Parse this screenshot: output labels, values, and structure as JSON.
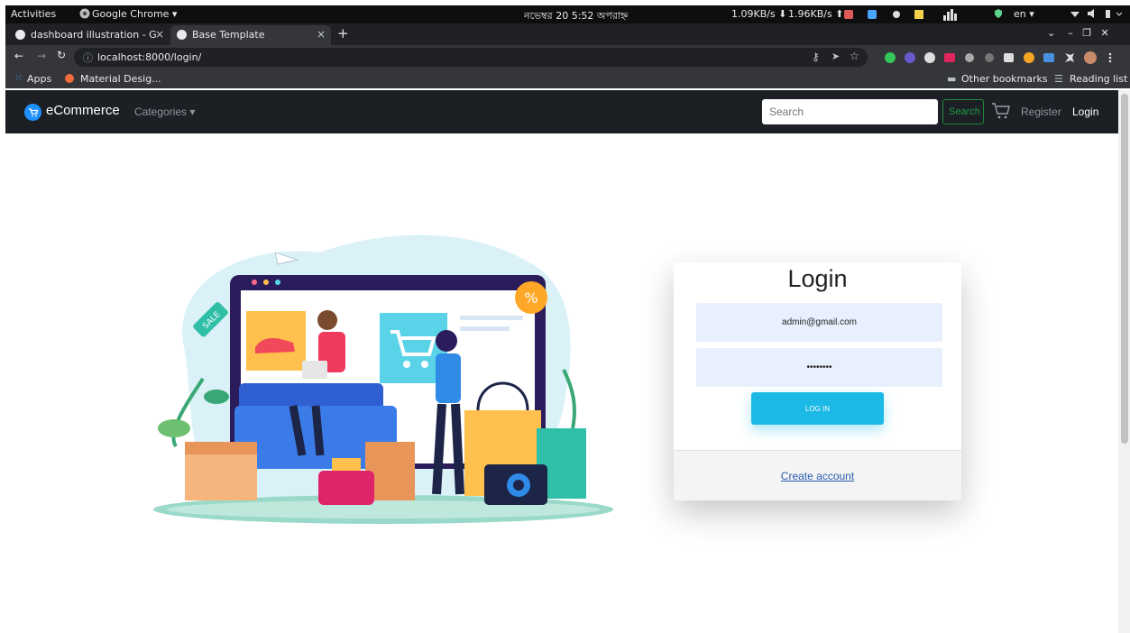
{
  "os": {
    "activities": "Activities",
    "app_menu": "Google Chrome ▾",
    "clock": "নভেম্বর 20  5:52 অপরাহ্ন",
    "net_down": "1.09KB/s ⬇",
    "net_up": "1.96KB/s ⬆",
    "lang": "en ▾"
  },
  "browser": {
    "tabs": [
      {
        "title": "dashboard illustration - G",
        "active": false
      },
      {
        "title": "Base Template",
        "active": true
      }
    ],
    "new_tab": "+",
    "url": "localhost:8000/login/",
    "bookmarks": {
      "apps": "Apps",
      "material": "Material Desig...",
      "other": "Other bookmarks",
      "reading": "Reading list"
    }
  },
  "site": {
    "brand": "eCommerce",
    "categories": "Categories ▾",
    "search_placeholder": "Search",
    "search_button": "Search",
    "register": "Register",
    "login": "Login"
  },
  "login_card": {
    "title": "Login",
    "email_value": "admin@gmail.com",
    "password_value": "••••••••",
    "login_button": "LOG IN",
    "create_account": "Create account"
  },
  "colors": {
    "navbar": "#1c2025",
    "accent": "#1cb8e6",
    "input_bg": "#e8f0fe",
    "search_green": "#1e9a45"
  }
}
